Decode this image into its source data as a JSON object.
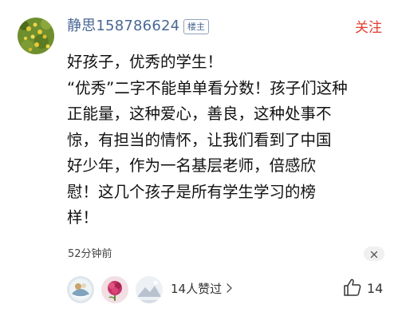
{
  "comment": {
    "username": "静思158786624",
    "badge": "楼主",
    "follow_label": "关注",
    "lines": [
      "好孩子，优秀的学生！",
      "“优秀”二字不能单单看分数！孩子们这种",
      "正能量，这种爱心，善良，这种处事不",
      "惊，有担当的情怀，让我们看到了中国",
      "好少年，作为一名基层老师，倍感欣",
      "慰！这几个孩子是所有学生学习的榜",
      "样！"
    ],
    "time": "52分钟前",
    "likes_summary": "14人赞过",
    "like_count": "14"
  },
  "icons": {
    "close": "close-icon",
    "chevron": "chevron-right-icon",
    "thumb": "thumbs-up-icon"
  },
  "colors": {
    "username": "#4a6795",
    "follow": "#e43d30",
    "text": "#111111",
    "meta": "#444444"
  }
}
